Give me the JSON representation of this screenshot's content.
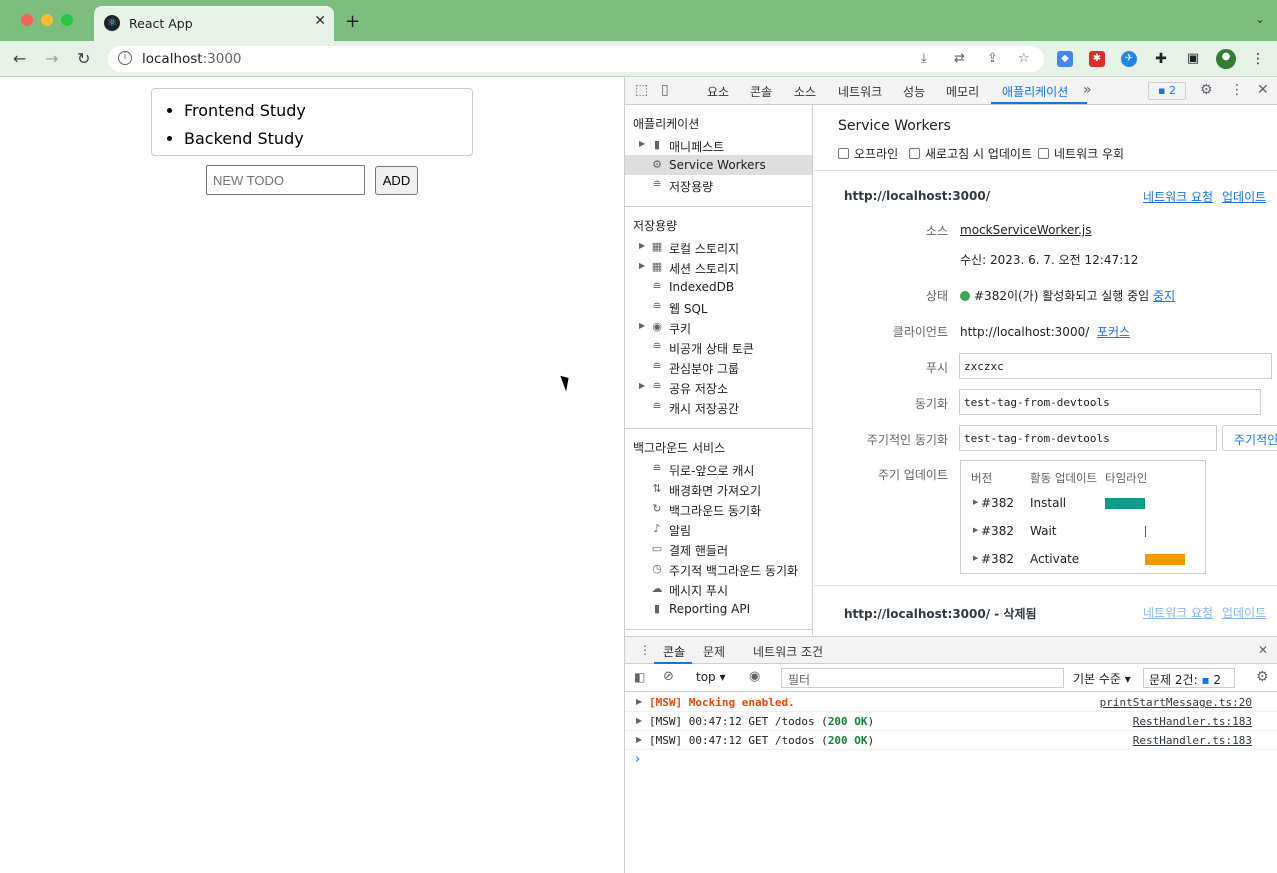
{
  "browser": {
    "tab_title": "React App",
    "tab_close": "✕",
    "new_tab": "+",
    "url_host": "localhost",
    "url_port": ":3000"
  },
  "app": {
    "todos": [
      "Frontend Study",
      "Backend Study"
    ],
    "input_placeholder": "NEW TODO",
    "add_label": "ADD"
  },
  "devtools": {
    "tabs": [
      "요소",
      "콘솔",
      "소스",
      "네트워크",
      "성능",
      "메모리",
      "애플리케이션"
    ],
    "active_tab": "애플리케이션",
    "issues_count": "2",
    "sidebar": {
      "section_app": "애플리케이션",
      "app_items": [
        "매니페스트",
        "Service Workers",
        "저장용량"
      ],
      "section_storage": "저장용량",
      "storage_items": [
        "로컬 스토리지",
        "세션 스토리지",
        "IndexedDB",
        "웹 SQL",
        "쿠키",
        "비공개 상태 토큰",
        "관심분야 그룹",
        "공유 저장소",
        "캐시 저장공간"
      ],
      "section_bg": "백그라운드 서비스",
      "bg_items": [
        "뒤로-앞으로 캐시",
        "배경화면 가져오기",
        "백그라운드 동기화",
        "알림",
        "결제 핸들러",
        "주기적 백그라운드 동기화",
        "메시지 푸시",
        "Reporting API"
      ]
    },
    "sw": {
      "title": "Service Workers",
      "checkbox_offline": "오프라인",
      "checkbox_update": "새로고침 시 업데이트",
      "checkbox_bypass": "네트워크 우회",
      "origin": "http://localhost:3000/",
      "network_requests": "네트워크 요청",
      "update": "업데이트",
      "source_label": "소스",
      "source_file": "mockServiceWorker.js",
      "received": "수신: 2023. 6. 7. 오전 12:47:12",
      "status_label": "상태",
      "status_text": "#382이(가) 활성화되고 실행 중임",
      "stop": "중지",
      "status_color": "#34a853",
      "client_label": "클라이언트",
      "client_url": "http://localhost:3000/",
      "focus": "포커스",
      "push_label": "푸시",
      "push_value": "zxczxc",
      "sync_label": "동기화",
      "sync_value": "test-tag-from-devtools",
      "periodic_sync_label": "주기적인 동기화",
      "periodic_sync_value": "test-tag-from-devtools",
      "periodic_sync_button": "주기적인",
      "update_cycle_label": "주기 업데이트",
      "tl_headers": [
        "버전",
        "활동 업데이트",
        "타임라인"
      ],
      "tl_rows": [
        {
          "version": "#382",
          "activity": "Install",
          "color": "#0f9d8a"
        },
        {
          "version": "#382",
          "activity": "Wait",
          "color": "#555555"
        },
        {
          "version": "#382",
          "activity": "Activate",
          "color": "#f29900"
        }
      ],
      "deleted_origin": "http://localhost:3000/ - 삭제됨"
    },
    "drawer": {
      "tabs": [
        "콘솔",
        "문제",
        "네트워크 조건"
      ],
      "context": "top",
      "filter_placeholder": "필터",
      "levels": "기본 수준",
      "issues": "문제 2건:",
      "issues_count": "2",
      "logs": [
        {
          "msg": "[MSW] Mocking enabled.",
          "src": "printStartMessage.ts:20"
        },
        {
          "msg_a": "[MSW] 00:47:12 GET /todos (",
          "status": "200 OK",
          "msg_b": ")",
          "src": "RestHandler.ts:183"
        },
        {
          "msg_a": "[MSW] 00:47:12 GET /todos (",
          "status": "200 OK",
          "msg_b": ")",
          "src": "RestHandler.ts:183"
        }
      ],
      "prompt": "›"
    }
  }
}
